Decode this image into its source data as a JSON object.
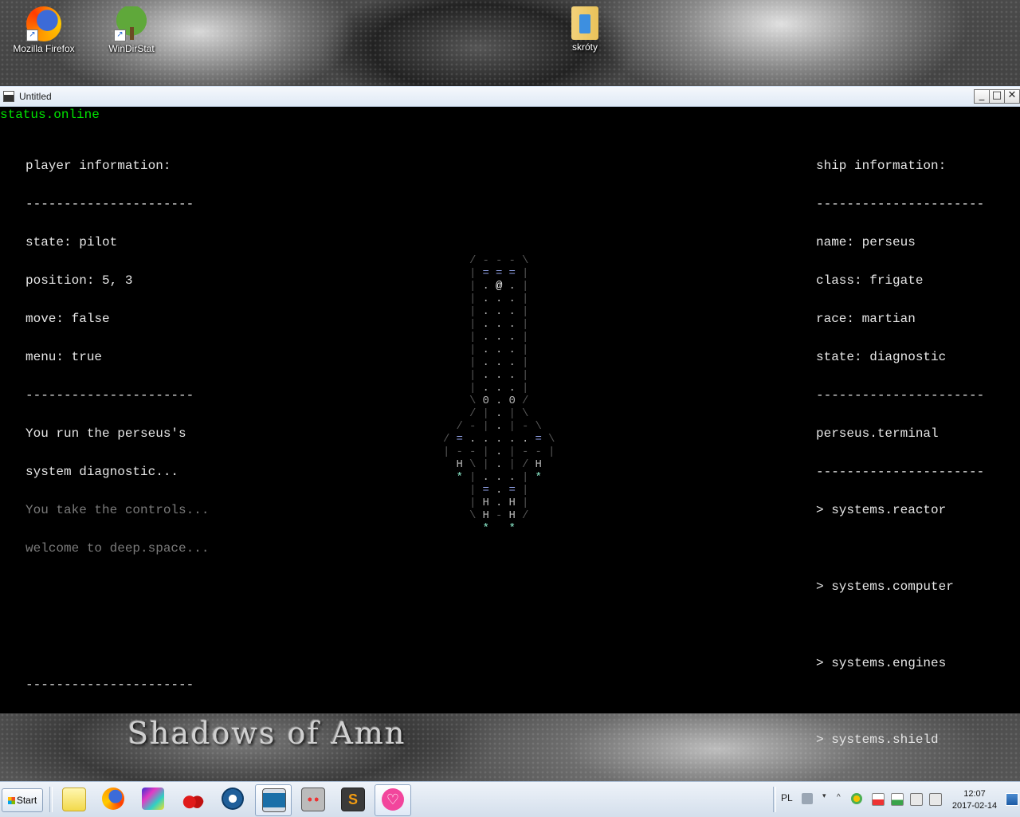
{
  "desktop": {
    "wallpaper_text": "Shadows of Amn",
    "icons": [
      {
        "label": "Mozilla Firefox",
        "icon": "firefox-icon"
      },
      {
        "label": "WinDirStat",
        "icon": "windirstat-icon"
      },
      {
        "label": "skróty",
        "icon": "folder-icon"
      }
    ]
  },
  "window": {
    "title": "Untitled",
    "minimize": "_",
    "maximize": "□",
    "close": "✕"
  },
  "terminal": {
    "status": "status.online",
    "player": {
      "heading": "player information:",
      "divider": "----------------------",
      "state": "state: pilot",
      "position": "position: 5, 3",
      "move": "move: false",
      "menu": "menu: true",
      "log": [
        "You run the perseus's",
        "system diagnostic...",
        "You take the controls...",
        "welcome to deep.space..."
      ]
    },
    "ship": {
      "heading": "ship information:",
      "divider": "----------------------",
      "name": "name: perseus",
      "class": "class: frigate",
      "race": "race: martian",
      "state": "state: diagnostic",
      "terminal_title": "perseus.terminal",
      "menu": [
        "> systems.reactor",
        "> systems.computer",
        "> systems.engines",
        "> systems.shield"
      ]
    },
    "ship_art": [
      "  /---\\  ",
      "  |===|  ",
      "  |.@.|  ",
      "  |...|  ",
      "  |...|  ",
      "  |...|  ",
      "  |...|  ",
      "  |...|  ",
      "  |...|  ",
      "  |...|  ",
      "  |...|  ",
      "  \\0.0/  ",
      "  /|.|\\  ",
      " /-|.|-\\ ",
      "/=.....=\\",
      "|--|.|--|",
      " H\\|.|/H ",
      " *|...|* ",
      "  |=.=|  ",
      "  |H.H|  ",
      "  \\H-H/  ",
      "   * *   "
    ]
  },
  "taskbar": {
    "start_label": "Start",
    "apps": [
      "sticky-notes-icon",
      "firefox-icon",
      "gale-icon",
      "cherry-icon",
      "network-icon",
      "terminal-window-icon",
      "robot-icon",
      "sublime-text-icon",
      "heart-app-icon"
    ],
    "language": "PL",
    "time": "12:07",
    "date": "2017-02-14"
  },
  "colors": {
    "terminal_bg": "#000000",
    "status_green": "#00e600",
    "text": "#e6e6e6",
    "dim_text": "#7a7a7a",
    "ship_equals": "#8fa0e6",
    "ship_star": "#8ff0d0"
  }
}
